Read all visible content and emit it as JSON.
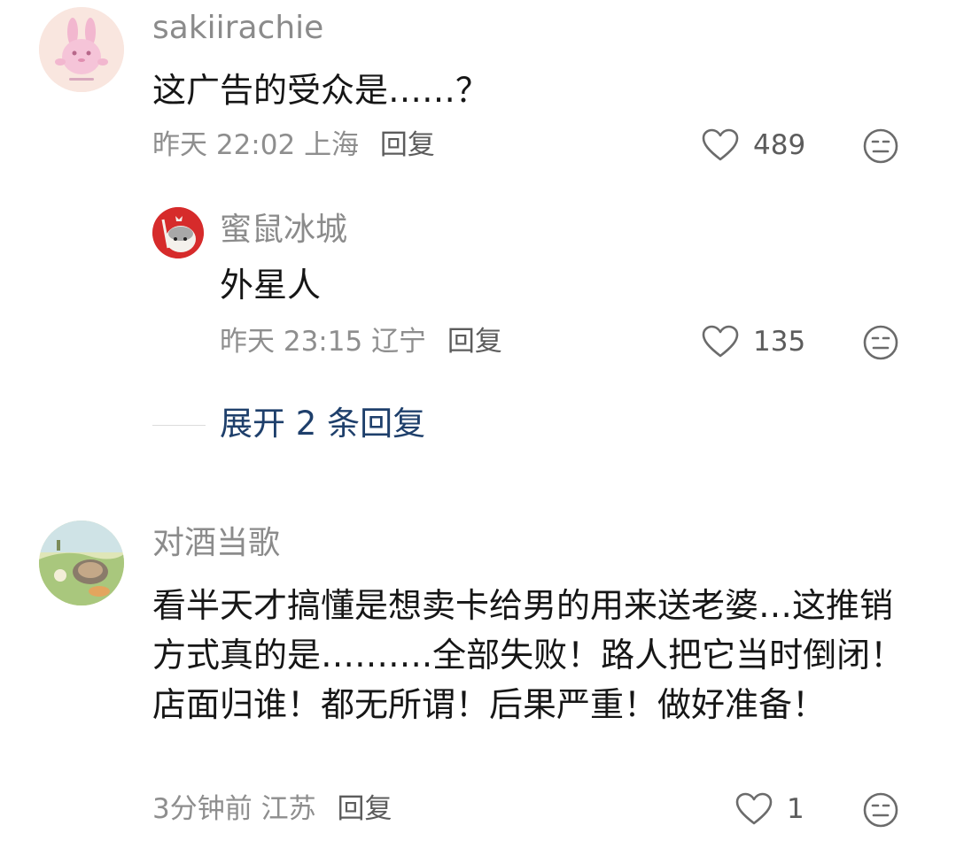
{
  "comments": [
    {
      "username": "sakiirachie",
      "text": "这广告的受众是……？",
      "time": "昨天 22:02",
      "location": "上海",
      "reply_label": "回复",
      "likes": "489"
    },
    {
      "username": "蜜鼠冰城",
      "text": "外星人",
      "time": "昨天 23:15",
      "location": "辽宁",
      "reply_label": "回复",
      "likes": "135"
    },
    {
      "username": "对酒当歌",
      "text": "看半天才搞懂是想卖卡给男的用来送老婆…这推销方式真的是……….全部失败！路人把它当时倒闭！店面归谁！都无所谓！后果严重！做好准备！",
      "time": "3分钟前",
      "location": "江苏",
      "reply_label": "回复",
      "likes": "1"
    }
  ],
  "expand_replies": "展开 2 条回复",
  "colors": {
    "username": "#8b8b8b",
    "meta": "#8e8e8e",
    "expand_link": "#1e3f6b"
  }
}
